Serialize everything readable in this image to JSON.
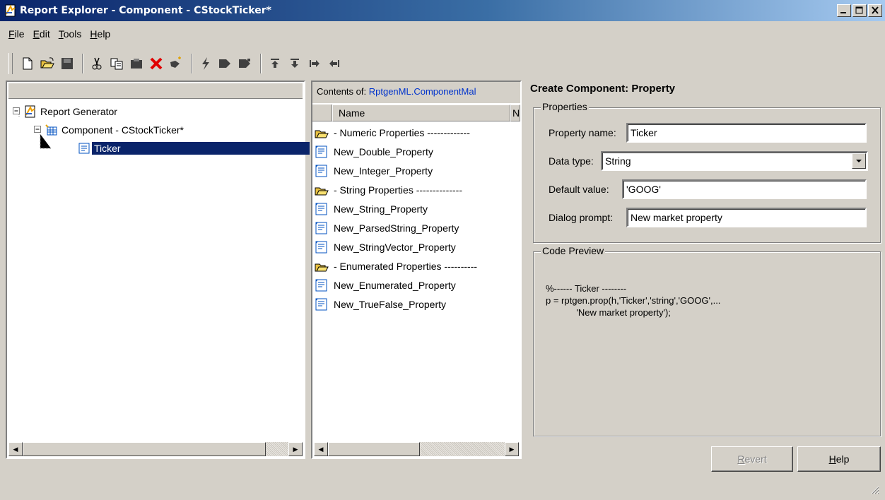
{
  "window": {
    "title": "Report Explorer - Component - CStockTicker*"
  },
  "menu": [
    {
      "label": "File",
      "accel": "F",
      "rest": "ile"
    },
    {
      "label": "Edit",
      "accel": "E",
      "rest": "dit"
    },
    {
      "label": "Tools",
      "accel": "T",
      "rest": "ools"
    },
    {
      "label": "Help",
      "accel": "H",
      "rest": "elp"
    }
  ],
  "toolbar": {
    "icons": [
      "new-icon",
      "open-icon",
      "save-icon",
      "cut-icon",
      "copy-icon",
      "paste-icon",
      "delete-icon",
      "add-component-icon",
      "generate-icon",
      "report-icon",
      "report-options-icon",
      "move-up-icon",
      "move-down-icon",
      "demote-icon",
      "promote-icon"
    ]
  },
  "tree": {
    "root": "Report Generator",
    "component": "Component - CStockTicker*",
    "property": "Ticker"
  },
  "contents": {
    "prefix": "Contents of:",
    "link": "RptgenML.ComponentMal",
    "column_name": "Name",
    "column_next": "N",
    "items": [
      {
        "label": "- Numeric Properties -------------",
        "type": "folder"
      },
      {
        "label": "New_Double_Property",
        "type": "prop"
      },
      {
        "label": "New_Integer_Property",
        "type": "prop"
      },
      {
        "label": "- String Properties --------------",
        "type": "folder"
      },
      {
        "label": "New_String_Property",
        "type": "prop"
      },
      {
        "label": "New_ParsedString_Property",
        "type": "prop"
      },
      {
        "label": "New_StringVector_Property",
        "type": "prop"
      },
      {
        "label": "- Enumerated Properties ----------",
        "type": "folder"
      },
      {
        "label": "New_Enumerated_Property",
        "type": "prop"
      },
      {
        "label": "New_TrueFalse_Property",
        "type": "prop"
      }
    ]
  },
  "properties_pane": {
    "title": "Create Component: Property",
    "group_label": "Properties",
    "property_name_label": "Property name:",
    "property_name_value": "Ticker",
    "data_type_label": "Data type:",
    "data_type_value": "String",
    "default_value_label": "Default value:",
    "default_value_value": "'GOOG'",
    "dialog_prompt_label": "Dialog prompt:",
    "dialog_prompt_value": "New market property"
  },
  "code_preview": {
    "group_label": "Code Preview",
    "lines": [
      "%------ Ticker --------",
      "p = rptgen.prop(h,'Ticker','string','GOOG',...",
      "            'New market property');"
    ]
  },
  "buttons": {
    "revert": {
      "accel": "R",
      "rest": "evert"
    },
    "help": {
      "accel": "H",
      "rest": "elp"
    }
  },
  "colors": {
    "selection": "#0a246a",
    "link": "#0033cc",
    "face": "#d4d0c8"
  }
}
